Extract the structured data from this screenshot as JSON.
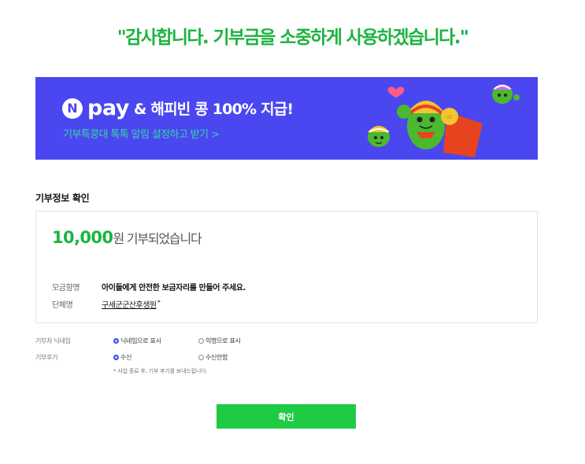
{
  "header": {
    "thanks_message": "\"감사합니다. 기부금을 소중하게 사용하겠습니다.\""
  },
  "banner": {
    "logo_letter": "N",
    "logo_word": "pay",
    "headline": "& 해피빈 콩 100% 지급!",
    "subtext": "기부특콩대 톡톡 알림 설정하고 받기 >",
    "background_color": "#4a47f0",
    "subtext_color": "#35d6a4"
  },
  "section": {
    "title": "기부정보 확인"
  },
  "summary": {
    "amount": "10,000",
    "amount_suffix": "원 기부되었습니다",
    "accent_color": "#1bb43f",
    "fundraiser_label": "모금함명",
    "fundraiser_value": "아이들에게 안전한 보금자리를 만들어 주세요.",
    "org_label": "단체명",
    "org_value": "구세군군산후생원",
    "org_arrow": "▸"
  },
  "options": {
    "nickname": {
      "label": "기부자 닉네임",
      "choices": [
        {
          "text": "닉네임으로 표시",
          "selected": true
        },
        {
          "text": "익명으로 표시",
          "selected": false
        }
      ]
    },
    "review": {
      "label": "기부후기",
      "choices": [
        {
          "text": "수신",
          "selected": true
        },
        {
          "text": "수신안함",
          "selected": false
        }
      ],
      "note": "* 사업 종료 후, 기부 후기를 보내드립니다."
    }
  },
  "confirm": {
    "label": "확인",
    "color": "#1ecb45"
  }
}
